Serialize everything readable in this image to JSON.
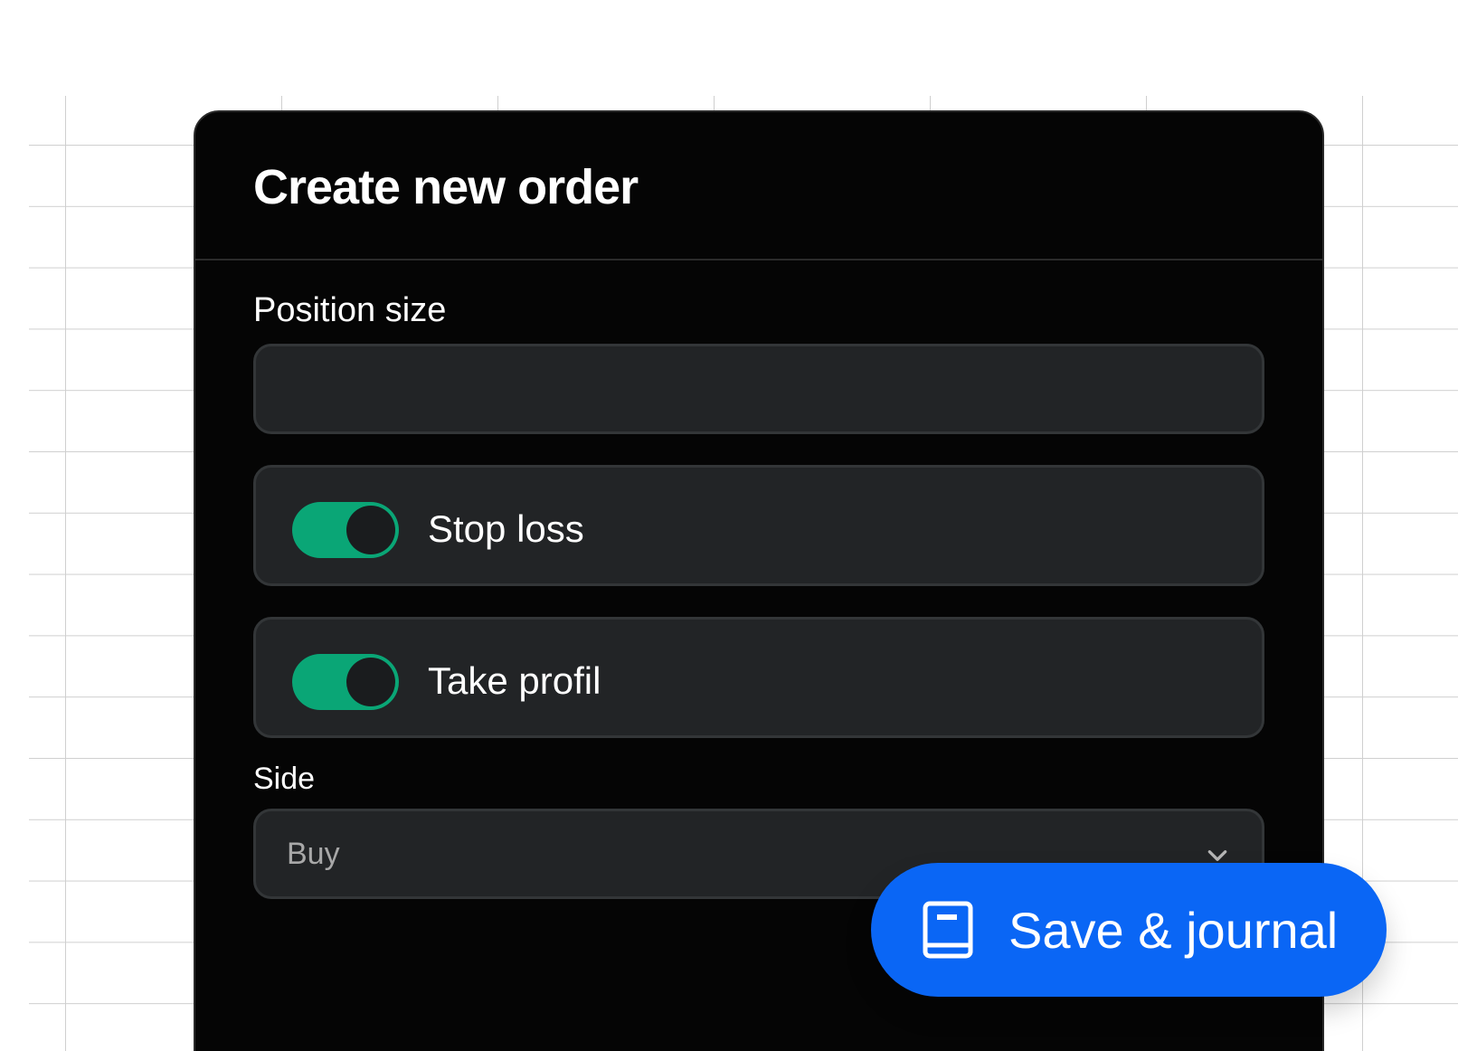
{
  "dialog": {
    "title": "Create new order"
  },
  "form": {
    "position_size": {
      "label": "Position size",
      "value": "",
      "placeholder": ""
    },
    "stop_loss": {
      "label": "Stop loss",
      "enabled": true
    },
    "take_profit": {
      "label": "Take profil",
      "enabled": true
    },
    "side": {
      "label": "Side",
      "selected": "Buy"
    }
  },
  "action": {
    "label": "Save & journal",
    "icon": "book-icon"
  },
  "colors": {
    "card_bg": "#050505",
    "field_bg": "#222426",
    "toggle_on": "#0aa676",
    "primary": "#0a66f5",
    "page_bg": "#ffffff"
  }
}
